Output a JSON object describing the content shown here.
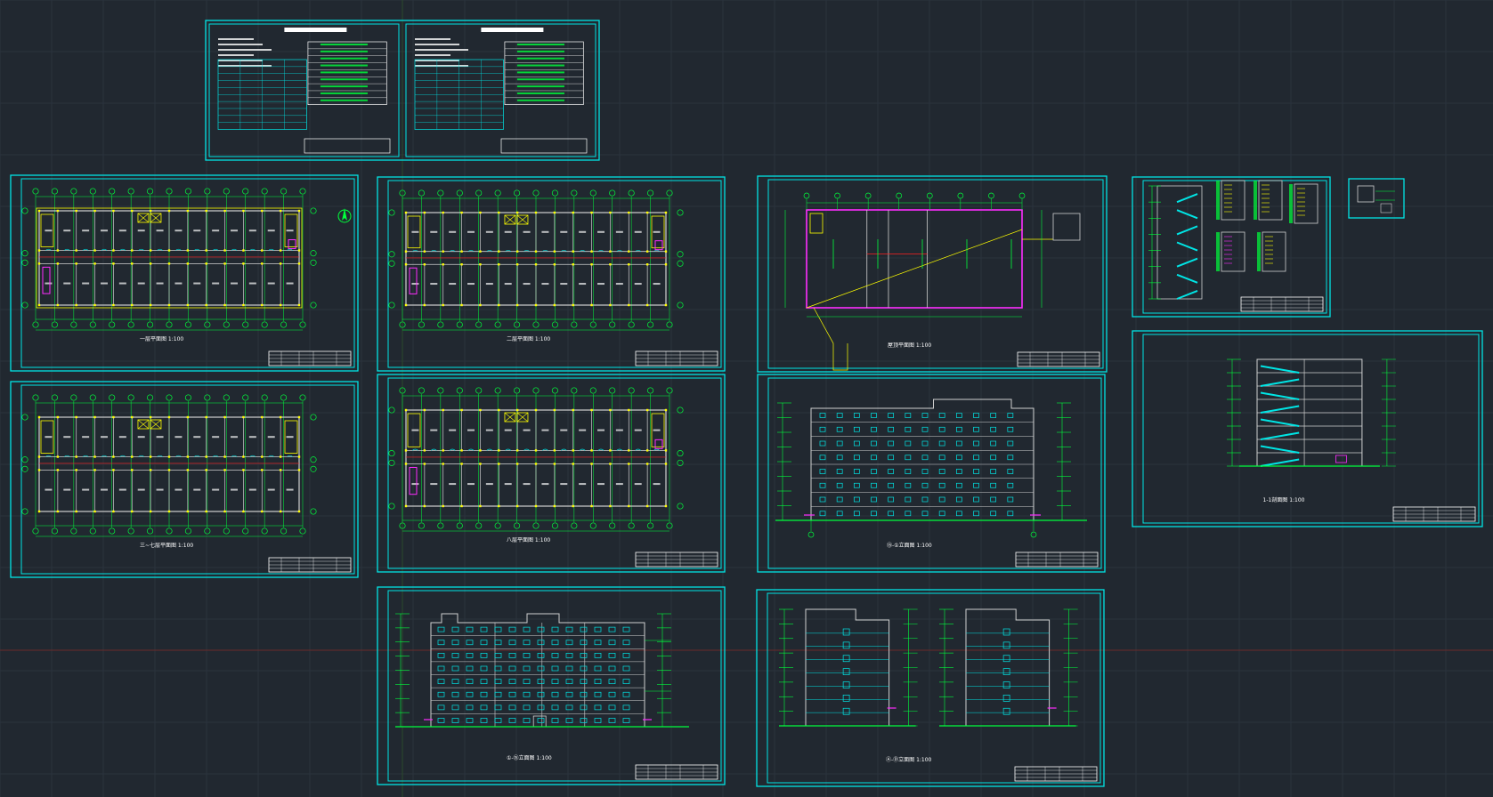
{
  "app": {
    "name": "CAD model space",
    "background_color": "#212830",
    "colors": {
      "frame": "#00e5e5",
      "grid_line": "#2a333d",
      "axis_x": "#7a2a2a",
      "axis_y": "#2e4a2e",
      "wall": "#d0d0d0",
      "dimension": "#00ff3c",
      "column": "#ffff00",
      "highlight": "#ff2dff",
      "red": "#ff2020",
      "stair": "#00e5e5",
      "title_block": "#ffffff"
    }
  },
  "drawing": {
    "sheets": [
      {
        "name": "design-notes-sheet",
        "kind": "notes"
      },
      {
        "name": "ground-floor-plan",
        "kind": "plan",
        "label": "一层平面图 1:100"
      },
      {
        "name": "second-floor-plan",
        "kind": "plan",
        "label": "二层平面图 1:100"
      },
      {
        "name": "roof-plan",
        "kind": "roof",
        "label": "屋顶平面图 1:100"
      },
      {
        "name": "stair-details",
        "kind": "stair"
      },
      {
        "name": "detail-small",
        "kind": "detail"
      },
      {
        "name": "typical-floor-plan",
        "kind": "plan",
        "label": "三~七层平面图 1:100"
      },
      {
        "name": "top-floor-plan",
        "kind": "plan",
        "label": "八层平面图 1:100"
      },
      {
        "name": "rear-elevation",
        "kind": "elevation",
        "label": "⑮-①立面图 1:100"
      },
      {
        "name": "section-1-1",
        "kind": "section",
        "label": "1-1剖面图 1:100"
      },
      {
        "name": "front-elevation",
        "kind": "elevation",
        "label": "①-⑮立面图 1:100"
      },
      {
        "name": "side-elevations",
        "kind": "side",
        "label": "Ⓐ-Ⓓ立面图 1:100"
      }
    ]
  }
}
